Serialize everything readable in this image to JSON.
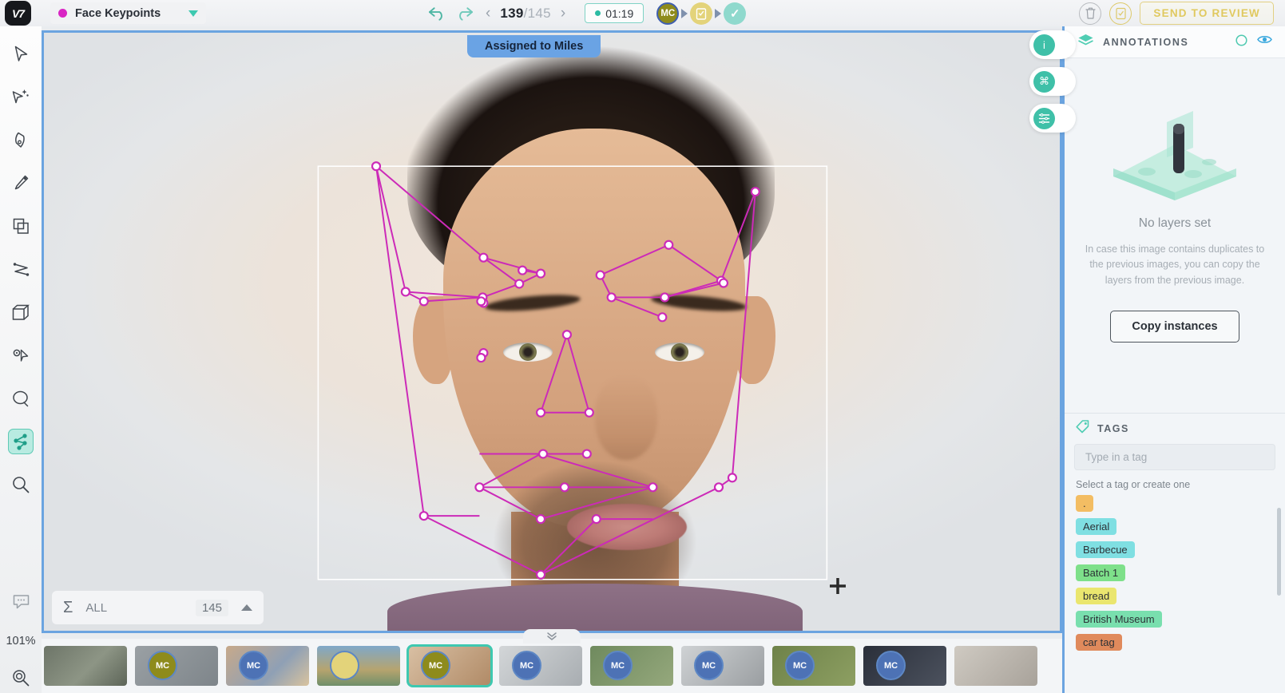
{
  "topbar": {
    "logo_text": "V7",
    "class_name": "Face Keypoints",
    "class_color": "#d925c4",
    "undo_icon": "undo-arrow-icon",
    "redo_icon": "redo-arrow-icon",
    "prev_label": "‹",
    "next_label": "›",
    "current_page": "139",
    "separator": "/",
    "total_pages": "145",
    "timer": "01:19",
    "stages": [
      {
        "label": "MC",
        "name": "annotate-stage"
      },
      {
        "label": "",
        "name": "review-stage"
      },
      {
        "label": "✓",
        "name": "complete-stage"
      }
    ],
    "delete_icon": "trash-icon",
    "review_icon": "clipboard-check-icon",
    "send_to_review": "SEND TO REVIEW"
  },
  "left_toolbar": {
    "tools": [
      {
        "name": "select-tool",
        "icon": "cursor-arrow-icon",
        "active": false
      },
      {
        "name": "auto-annotate-tool",
        "icon": "magic-wand-icon",
        "active": false
      },
      {
        "name": "pen-tool",
        "icon": "pen-nib-icon",
        "active": false
      },
      {
        "name": "brush-tool",
        "icon": "brush-icon",
        "active": false
      },
      {
        "name": "bounding-box-tool",
        "icon": "copy-rectangles-icon",
        "active": false
      },
      {
        "name": "polyline-tool",
        "icon": "polyline-icon",
        "active": false
      },
      {
        "name": "cuboid-tool",
        "icon": "cube-icon",
        "active": false
      },
      {
        "name": "keypoint-tool",
        "icon": "keypoint-icon",
        "active": false
      },
      {
        "name": "ellipse-tool",
        "icon": "ellipse-icon",
        "active": false
      },
      {
        "name": "skeleton-tool",
        "icon": "skeleton-icon",
        "active": true
      },
      {
        "name": "zoom-tool",
        "icon": "magnifier-icon",
        "active": false
      }
    ],
    "comment_icon": "comment-bubble-icon",
    "zoom_level": "101%",
    "reset_zoom_icon": "reset-zoom-icon"
  },
  "canvas": {
    "assigned_badge": "Assigned to Miles",
    "annotation_color": "#cc2ab8",
    "bbox_color": "#ffffff",
    "cursor_icon": "crosshair-cursor",
    "summary": {
      "sigma_icon": "sigma-icon",
      "label": "ALL",
      "count": "145",
      "collapse_icon": "chevron-up-icon"
    }
  },
  "right_panel": {
    "side_tabs": [
      {
        "name": "info-tab",
        "icon": "info-icon",
        "label": "i"
      },
      {
        "name": "shortcuts-tab",
        "icon": "command-key-icon",
        "label": "⌘"
      },
      {
        "name": "settings-tab",
        "icon": "list-settings-icon",
        "label": "☷"
      }
    ],
    "annotations": {
      "layers_icon": "layers-icon",
      "title": "ANNOTATIONS",
      "circle_icon": "circle-outline-icon",
      "eye_icon": "eye-icon",
      "empty_title": "No layers set",
      "empty_desc": "In case this image contains duplicates to the previous images, you can copy the layers from the previous image.",
      "copy_button": "Copy instances"
    },
    "tags": {
      "tag_icon": "tag-icon",
      "title": "TAGS",
      "input_placeholder": "Type in a tag",
      "input_value": "",
      "hint": "Select a tag or create one",
      "items": [
        {
          "label": ".",
          "color": "#f3bd63"
        },
        {
          "label": "Aerial",
          "color": "#7fdfe2"
        },
        {
          "label": "Barbecue",
          "color": "#7fdfe2"
        },
        {
          "label": "Batch 1",
          "color": "#7ee08a"
        },
        {
          "label": "bread",
          "color": "#eae66f"
        },
        {
          "label": "British Museum",
          "color": "#79dfae"
        },
        {
          "label": "car tag",
          "color": "#e08a5c"
        }
      ]
    }
  },
  "filmstrip": {
    "collapse_icon": "chevron-double-down-icon",
    "thumbnails": [
      {
        "name": "thumb-1",
        "avatar": "",
        "avatar_color": "",
        "selected": false,
        "bg": "linear-gradient(135deg,#6d7568 0%,#8d9585 55%,#5d6558 100%)"
      },
      {
        "name": "thumb-2",
        "avatar": "MC",
        "avatar_color": "#8e8b1c",
        "selected": false,
        "bg": "linear-gradient(135deg,#9aa0a4 0%,#7e858a 100%)"
      },
      {
        "name": "thumb-3",
        "avatar": "MC",
        "avatar_color": "#4d72b5",
        "selected": false,
        "bg": "linear-gradient(135deg,#c7a98a 0%,#8fa0b5 60%,#d9c39e 100%)"
      },
      {
        "name": "thumb-4",
        "avatar": "",
        "avatar_color": "#e3d37a",
        "selected": false,
        "bg": "linear-gradient(180deg,#7fa8c9 0%,#b6a46e 60%,#6f8f6a 100%)"
      },
      {
        "name": "thumb-5",
        "avatar": "MC",
        "avatar_color": "#8e8b1c",
        "selected": true,
        "bg": "linear-gradient(135deg,#d9c0a4 0%,#b08a66 100%)"
      },
      {
        "name": "thumb-6",
        "avatar": "MC",
        "avatar_color": "#4d72b5",
        "selected": false,
        "bg": "linear-gradient(135deg,#d3d6d8 0%,#a8adb1 100%)"
      },
      {
        "name": "thumb-7",
        "avatar": "MC",
        "avatar_color": "#4d72b5",
        "selected": false,
        "bg": "linear-gradient(135deg,#6f8a5e 0%,#95a87c 100%)"
      },
      {
        "name": "thumb-8",
        "avatar": "MC",
        "avatar_color": "#4d72b5",
        "selected": false,
        "bg": "linear-gradient(135deg,#cfd2d4 0%,#9a9ea1 100%)"
      },
      {
        "name": "thumb-9",
        "avatar": "MC",
        "avatar_color": "#4d72b5",
        "selected": false,
        "bg": "linear-gradient(135deg,#6e8249 0%,#8d9f62 100%)"
      },
      {
        "name": "thumb-10",
        "avatar": "MC",
        "avatar_color": "#4d72b5",
        "selected": false,
        "bg": "linear-gradient(135deg,#2a2f3a 0%,#4c525e 100%)"
      },
      {
        "name": "thumb-11",
        "avatar": "",
        "avatar_color": "",
        "selected": false,
        "bg": "linear-gradient(135deg,#cfcac2 0%,#a8a29a 100%)"
      }
    ]
  }
}
